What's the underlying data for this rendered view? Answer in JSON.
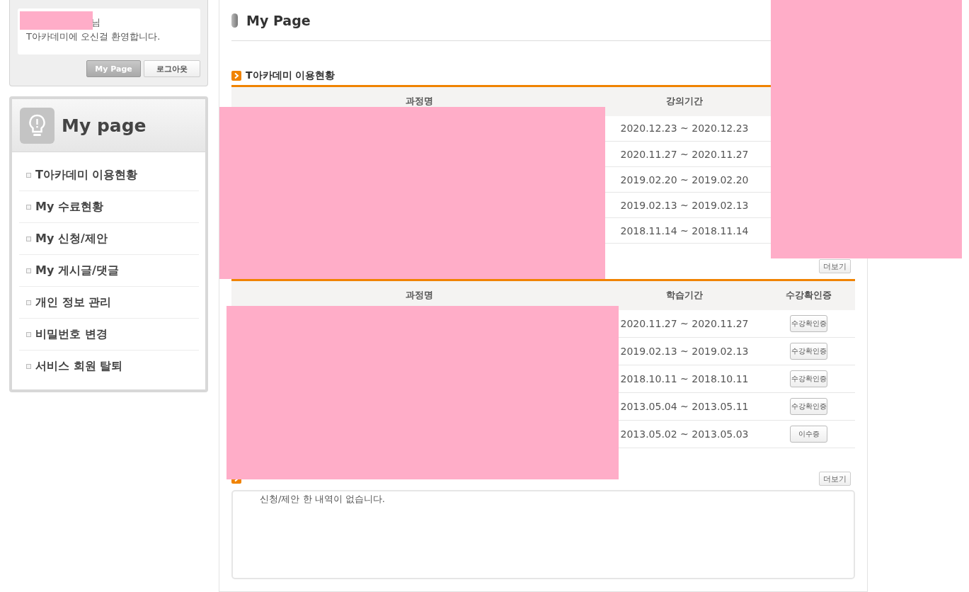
{
  "login": {
    "greeting_suffix": "님",
    "welcome": "T아카데미에 오신걸 환영합니다.",
    "buttons": [
      {
        "label": "My Page",
        "selected": true
      },
      {
        "label": "로그아웃",
        "selected": false
      }
    ]
  },
  "sidebar": {
    "title": "My page",
    "items": [
      {
        "label": "T아카데미 이용현황"
      },
      {
        "label": "My 수료현황"
      },
      {
        "label": "My 신청/제안"
      },
      {
        "label": "My 게시글/댓글"
      },
      {
        "label": "개인 정보 관리"
      },
      {
        "label": "비밀번호 변경"
      },
      {
        "label": "서비스 회원 탈퇴"
      }
    ]
  },
  "page_title": "My Page",
  "usage": {
    "title": "T아카데미 이용현황",
    "columns": [
      "과정명",
      "강의기간"
    ],
    "rows": [
      {
        "period": "2020.12.23 ~ 2020.12.23"
      },
      {
        "period": "2020.11.27 ~ 2020.11.27"
      },
      {
        "period": "2019.02.20 ~ 2019.02.20"
      },
      {
        "period": "2019.02.13 ~ 2019.02.13"
      },
      {
        "period": "2018.11.14 ~ 2018.11.14"
      }
    ],
    "more": "더보기"
  },
  "completion": {
    "columns": [
      "과정명",
      "학습기간",
      "수강확인증"
    ],
    "rows": [
      {
        "period": "2020.11.27 ~ 2020.11.27",
        "action": "수강확인증"
      },
      {
        "period": "2019.02.13 ~ 2019.02.13",
        "action": "수강확인증"
      },
      {
        "period": "2018.10.11 ~ 2018.10.11",
        "action": "수강확인증"
      },
      {
        "period": "2013.05.04 ~ 2013.05.11",
        "action": "수강확인증"
      },
      {
        "period": "2013.05.02 ~ 2013.05.03",
        "action": "이수증"
      }
    ]
  },
  "requests": {
    "more": "더보기",
    "empty_message": "신청/제안 한 내역이 없습니다."
  },
  "redactions": [
    {
      "kind": "block"
    },
    {
      "kind": "block"
    },
    {
      "kind": "block"
    },
    {
      "kind": "block"
    }
  ]
}
